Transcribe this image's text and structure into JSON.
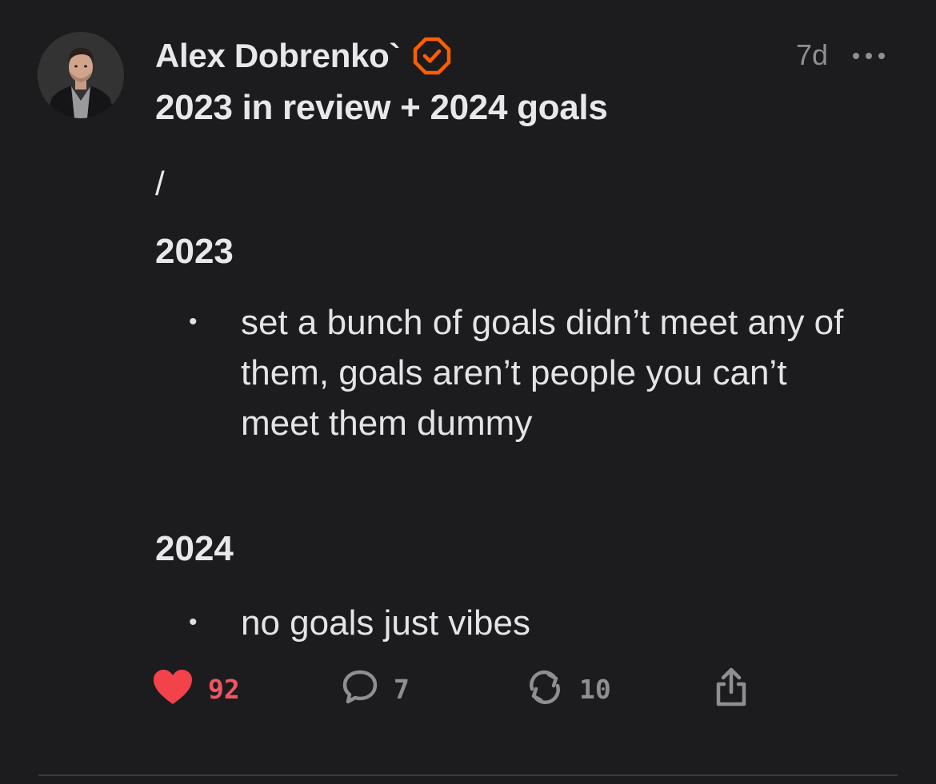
{
  "author": {
    "name": "Alex Dobrenko`",
    "verified_icon": "verified-badge-icon",
    "verified_color": "#ff5e00"
  },
  "post": {
    "timestamp": "7d",
    "title": "2023 in review + 2024 goals",
    "separator": "/",
    "sections": [
      {
        "heading": "2023",
        "bullets": [
          "set a bunch of goals didn’t meet any of them, goals aren’t people you can’t meet them dummy"
        ]
      },
      {
        "heading": "2024",
        "bullets": [
          "no goals just vibes"
        ]
      }
    ]
  },
  "actions": {
    "like": {
      "icon": "heart-icon",
      "count": "92",
      "color": "#f25560"
    },
    "reply": {
      "icon": "comment-icon",
      "count": "7"
    },
    "repost": {
      "icon": "repost-icon",
      "count": "10"
    },
    "share": {
      "icon": "share-icon"
    }
  },
  "colors": {
    "background": "#1c1c1e",
    "text": "#e8e8ea",
    "muted": "#8e8e93"
  }
}
